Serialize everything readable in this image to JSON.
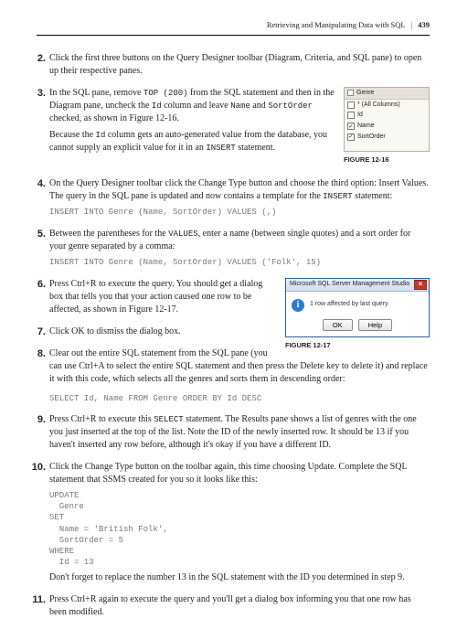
{
  "header": {
    "title": "Retrieving and Manipulating Data with SQL",
    "page": "439"
  },
  "steps": {
    "s2": {
      "p1a": "Click the first three buttons on the Query Designer toolbar (Diagram, Criteria, and SQL pane) to open up their respective panes."
    },
    "s3": {
      "p1a": "In the SQL pane, remove ",
      "c1": "TOP (200)",
      "p1b": " from the SQL statement and then in the Diagram pane, uncheck the ",
      "c2": "Id",
      "p1c": " column and leave ",
      "c3": "Name",
      "p1d": " and ",
      "c4": "SortOrder",
      "p1e": " checked, as shown in Figure 12-16.",
      "p2a": "Because the ",
      "c5": "Id",
      "p2b": " column gets an auto-generated value from the database, you cannot supply an explicit value for it in an ",
      "c6": "INSERT",
      "p2c": " statement."
    },
    "s4": {
      "p1a": "On the Query Designer toolbar click the Change Type button and choose the third option: Insert Values. The query in the SQL pane is updated and now contains a template for the ",
      "c1": "INSERT",
      "p1b": " statement:",
      "code": "INSERT INTO Genre (Name, SortOrder) VALUES (,)"
    },
    "s5": {
      "p1a": "Between the parentheses for the ",
      "c1": "VALUES",
      "p1b": ", enter a name (between single quotes) and a sort order for your genre separated by a comma:",
      "code": "INSERT INTO Genre (Name, SortOrder) VALUES ('Folk', 15)"
    },
    "s6": {
      "p1": "Press Ctrl+R to execute the query. You should get a dialog box that tells you that your action caused one row to be affected, as shown in Figure 12-17."
    },
    "s7": {
      "p1": "Click OK to dismiss the dialog box."
    },
    "s8": {
      "p1": "Clear out the entire SQL statement from the SQL pane (you can use Ctrl+A to select the entire SQL statement and then press the Delete key to delete it) and replace it with this code, which selects all the genres and sorts them in descending order:",
      "code": "SELECT Id, Name FROM Genre ORDER BY Id DESC"
    },
    "s9": {
      "p1a": "Press Ctrl+R to execute this ",
      "c1": "SELECT",
      "p1b": " statement. The Results pane shows a list of genres with the one you just inserted at the top of the list. Note the ID of the newly inserted row. It should be 13 if you haven't inserted any row before, although it's okay if you have a different ID."
    },
    "s10": {
      "p1": "Click the Change Type button on the toolbar again, this time choosing Update. Complete the SQL statement that SSMS created for you so it looks like this:",
      "code": "UPDATE\n  Genre\nSET\n  Name = 'British Folk',\n  SortOrder = 5\nWHERE\n  Id = 13",
      "p2": "Don't forget to replace the number 13 in the SQL statement with the ID you determined in step 9."
    },
    "s11": {
      "p1": "Press Ctrl+R again to execute the query and you'll get a dialog box informing you that one row has been modified."
    }
  },
  "fig16": {
    "caption": "FIGURE 12-16",
    "header": "Genre",
    "rows": [
      {
        "label": "* (All Columns)",
        "checked": false
      },
      {
        "label": "Id",
        "checked": false
      },
      {
        "label": "Name",
        "checked": true
      },
      {
        "label": "SortOrder",
        "checked": true
      }
    ]
  },
  "fig17": {
    "caption": "FIGURE 12-17",
    "title": "Microsoft SQL Server Management Studio",
    "message": "1 row affected by last query",
    "ok": "OK",
    "help": "Help"
  }
}
